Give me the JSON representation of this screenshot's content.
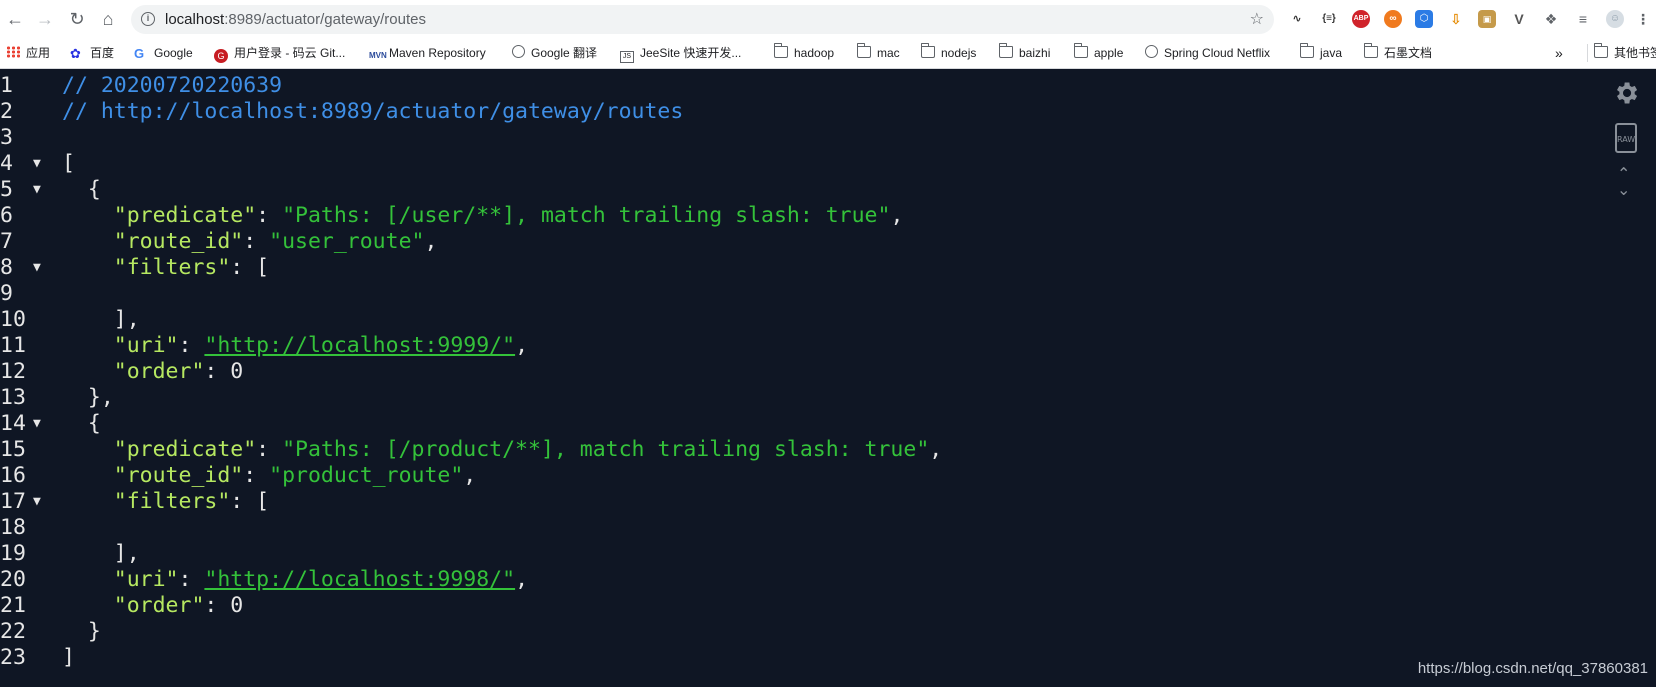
{
  "browser": {
    "url_host": "localhost",
    "url_rest": ":8989/actuator/gateway/routes",
    "bookmarks": [
      {
        "label": "应用",
        "icon": "apps-grid-icon"
      },
      {
        "label": "百度",
        "icon": "baidu-paw-icon"
      },
      {
        "label": "Google",
        "icon": "google-g-icon"
      },
      {
        "label": "用户登录 - 码云 Git...",
        "icon": "gitee-icon"
      },
      {
        "label": "Maven Repository",
        "icon": "mvn-icon"
      },
      {
        "label": "Google 翻译",
        "icon": "globe-icon"
      },
      {
        "label": "JeeSite 快速开发...",
        "icon": "js-icon"
      },
      {
        "label": "hadoop",
        "icon": "folder-icon"
      },
      {
        "label": "mac",
        "icon": "folder-icon"
      },
      {
        "label": "nodejs",
        "icon": "folder-icon"
      },
      {
        "label": "baizhi",
        "icon": "folder-icon"
      },
      {
        "label": "apple",
        "icon": "folder-icon"
      },
      {
        "label": "Spring Cloud Netflix",
        "icon": "globe-icon"
      },
      {
        "label": "java",
        "icon": "folder-icon"
      },
      {
        "label": "石墨文档",
        "icon": "folder-icon"
      },
      {
        "label": "其他书签",
        "icon": "folder-icon"
      }
    ],
    "overflow": "»"
  },
  "json_view": {
    "comment_timestamp": "// 20200720220639",
    "comment_url": "// http://localhost:8989/actuator/gateway/routes",
    "routes": [
      {
        "predicate": "\"Paths: [/user/**], match trailing slash: true\"",
        "route_id": "\"user_route\"",
        "uri": "\"http://localhost:9999/\"",
        "order": "0"
      },
      {
        "predicate": "\"Paths: [/product/**], match trailing slash: true\"",
        "route_id": "\"product_route\"",
        "uri": "\"http://localhost:9998/\"",
        "order": "0"
      }
    ],
    "keys": {
      "predicate": "\"predicate\"",
      "route_id": "\"route_id\"",
      "filters": "\"filters\"",
      "uri": "\"uri\"",
      "order": "\"order\""
    },
    "line_numbers": [
      "1",
      "2",
      "3",
      "4",
      "5",
      "6",
      "7",
      "8",
      "9",
      "10",
      "11",
      "12",
      "13",
      "14",
      "15",
      "16",
      "17",
      "18",
      "19",
      "20",
      "21",
      "22",
      "23"
    ]
  },
  "watermark": "https://blog.csdn.net/qq_37860381",
  "colors": {
    "background": "#0f1624",
    "comment": "#3f8fe6",
    "key": "#b6e861",
    "string": "#34c23a"
  }
}
